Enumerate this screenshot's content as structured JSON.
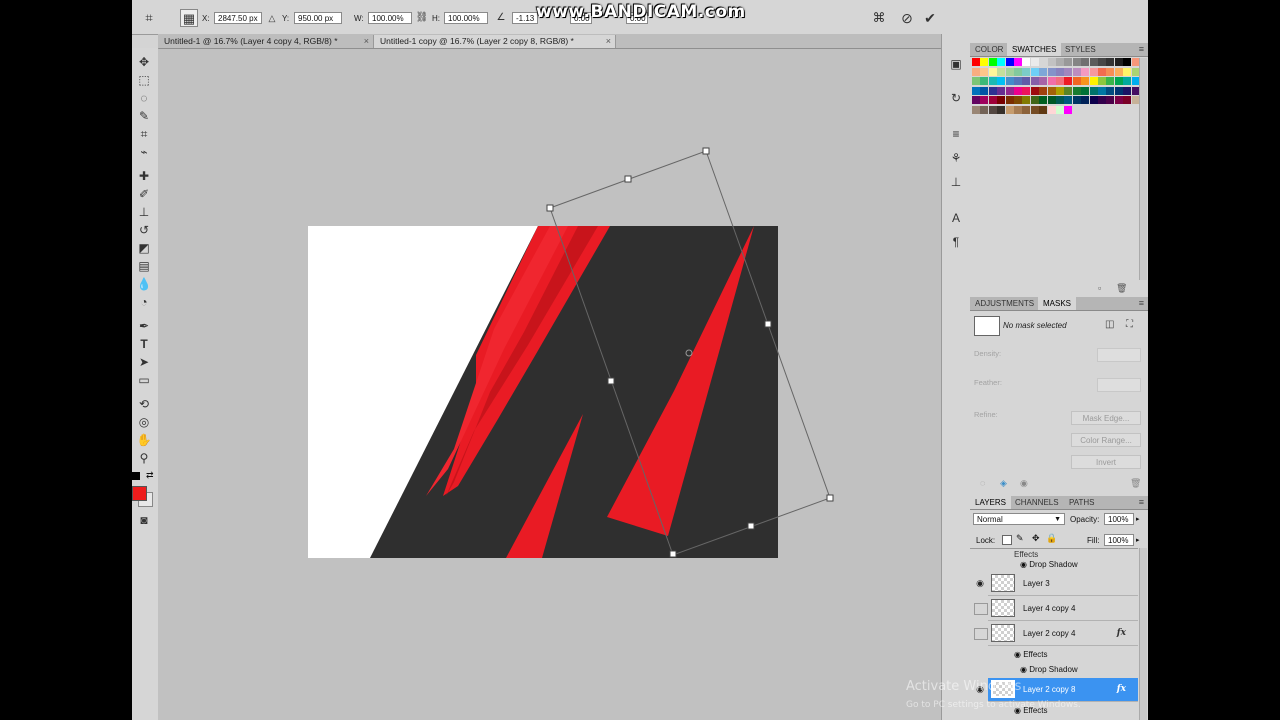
{
  "options_bar": {
    "x_label": "X:",
    "x_value": "2847.50 px",
    "y_label": "Y:",
    "y_value": "950.00 px",
    "w_label": "W:",
    "w_value": "100.00%",
    "h_label": "H:",
    "h_value": "100.00%",
    "angle_value": "-1.13",
    "skew_h_value": "0.00",
    "skew_v_value": "0.00"
  },
  "watermark": "www.BANDICAM.com",
  "documents": {
    "tabs": [
      {
        "label": "Untitled-1 @ 16.7% (Layer 4 copy 4, RGB/8) *",
        "close": "×"
      },
      {
        "label": "Untitled-1 copy @ 16.7% (Layer 2 copy 8, RGB/8) *",
        "close": "×"
      }
    ]
  },
  "swatches_panel": {
    "tabs": [
      "COLOR",
      "SWATCHES",
      "STYLES"
    ],
    "active_tab": "SWATCHES",
    "colors": [
      "#ff0000",
      "#ffff00",
      "#00ff00",
      "#00ffff",
      "#0000ff",
      "#ff00ff",
      "#ffffff",
      "#ebebeb",
      "#d6d6d6",
      "#c2c2c2",
      "#adadad",
      "#999999",
      "#858585",
      "#707070",
      "#5c5c5c",
      "#474747",
      "#333333",
      "#1f1f1f",
      "#000000",
      "#f7977a",
      "#f9ad81",
      "#fdc68a",
      "#fff79a",
      "#c4df9b",
      "#a3d39c",
      "#82ca9d",
      "#7bcdc8",
      "#6ecff6",
      "#7ea7d8",
      "#8493ca",
      "#8882be",
      "#a187be",
      "#bc8dbf",
      "#f49ac2",
      "#f6989d",
      "#f26c4f",
      "#f68e55",
      "#fbaf5c",
      "#fff467",
      "#acd372",
      "#7cc576",
      "#3bb878",
      "#1abbb4",
      "#00bff3",
      "#438cca",
      "#5574b9",
      "#605ca8",
      "#855fa8",
      "#a763a8",
      "#f06ea9",
      "#f26d7d",
      "#ed1c24",
      "#f26522",
      "#f7941d",
      "#fff200",
      "#8dc73f",
      "#39b54a",
      "#00a651",
      "#00a99d",
      "#00aeef",
      "#0072bc",
      "#0054a6",
      "#2e3192",
      "#662d91",
      "#92278f",
      "#ec008c",
      "#ed145b",
      "#9e0b0f",
      "#a0410d",
      "#a36209",
      "#aba000",
      "#598527",
      "#197b30",
      "#007236",
      "#00746b",
      "#0076a3",
      "#004b80",
      "#003471",
      "#1b1464",
      "#440e62",
      "#630460",
      "#9e005d",
      "#9e0039",
      "#790000",
      "#7b2e00",
      "#7d4900",
      "#827b00",
      "#406618",
      "#005e20",
      "#005826",
      "#005952",
      "#005b7f",
      "#003663",
      "#002157",
      "#0d004c",
      "#32004b",
      "#4b0049",
      "#7b0046",
      "#7a0026",
      "#c7b299",
      "#998675",
      "#736357",
      "#534741",
      "#37302a",
      "#c69c6d",
      "#a67c52",
      "#8c6239",
      "#754c24",
      "#603913",
      "#ffd6d6",
      "#d0ffd0",
      "#ff00ff"
    ],
    "menu_glyph": "≡"
  },
  "masks_panel": {
    "tabs": [
      "ADJUSTMENTS",
      "MASKS"
    ],
    "active_tab": "MASKS",
    "status": "No mask selected",
    "density_label": "Density:",
    "feather_label": "Feather:",
    "refine_label": "Refine:",
    "mask_edge_button": "Mask Edge...",
    "color_range_button": "Color Range...",
    "invert_button": "Invert"
  },
  "layers_panel": {
    "tabs": [
      "LAYERS",
      "CHANNELS",
      "PATHS"
    ],
    "active_tab": "LAYERS",
    "blend_mode": "Normal",
    "opacity_label": "Opacity:",
    "opacity_value": "100%",
    "lock_label": "Lock:",
    "fill_label": "Fill:",
    "fill_value": "100%",
    "top_partial_effects": "Effects",
    "top_drop_shadow": "Drop Shadow",
    "layers": [
      {
        "name": "Layer 3",
        "visible": true
      },
      {
        "name": "Layer 4 copy 4",
        "visible": false
      },
      {
        "name": "Layer 2 copy 4",
        "visible": false,
        "fx": "fx"
      },
      {
        "name": "Layer 2 copy 8",
        "visible": true,
        "fx": "fx",
        "selected": true
      }
    ],
    "effects_label": "Effects",
    "drop_shadow_label": "Drop Shadow",
    "bottom_effects": "Effects"
  },
  "activate_windows": {
    "title": "Activate Windows",
    "subtitle": "Go to PC settings to activate Windows."
  },
  "colors": {
    "accent_red": "#ed1c24",
    "canvas_dark": "#2f2f2f",
    "selection_blue": "#3b93f1"
  }
}
